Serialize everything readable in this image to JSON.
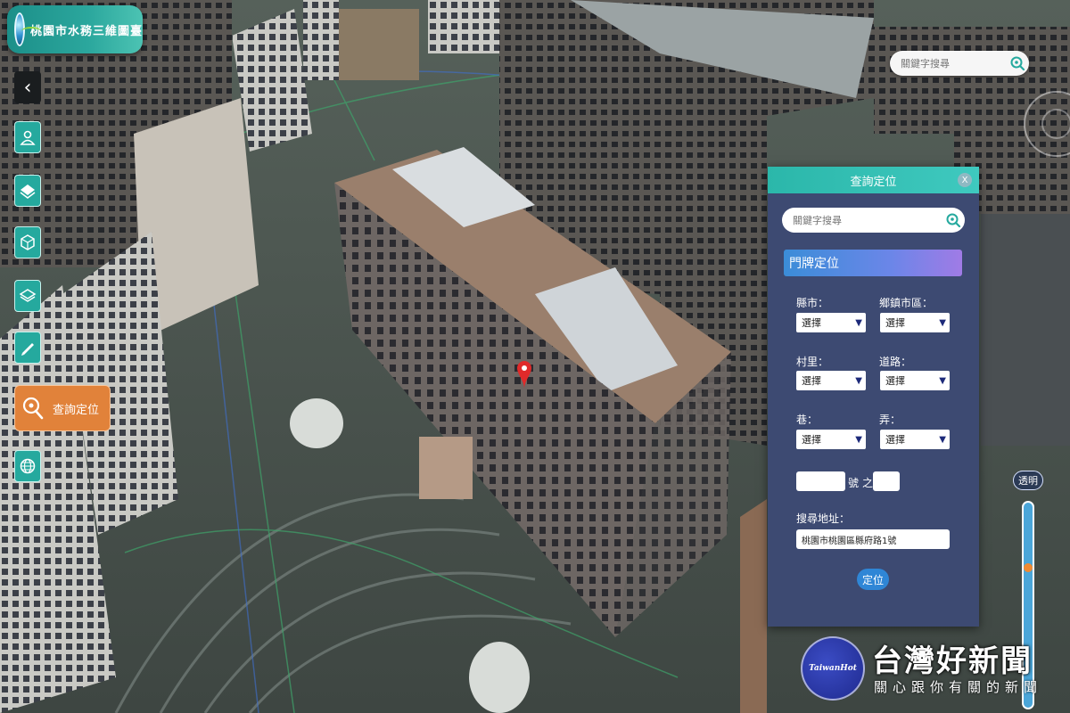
{
  "app": {
    "title": "桃園市水務三維圖臺"
  },
  "sidebar": {
    "collapse_glyph": "‹",
    "items": [
      {
        "icon": "person-icon"
      },
      {
        "icon": "layer-card-icon"
      },
      {
        "icon": "box-tool-icon"
      },
      {
        "icon": "layers-icon"
      },
      {
        "icon": "ruler-pencil-icon"
      },
      {
        "icon": "search-icon",
        "label": "查詢定位",
        "active": true
      },
      {
        "icon": "globe-icon"
      }
    ]
  },
  "top_search": {
    "placeholder": "關鍵字搜尋"
  },
  "panel": {
    "title": "查詢定位",
    "close_glyph": "X",
    "search_placeholder": "關鍵字搜尋",
    "section": "門牌定位",
    "fields": {
      "county_label": "縣市：",
      "county_value": "選擇",
      "district_label": "鄉鎮市區：",
      "district_value": "選擇",
      "village_label": "村里：",
      "village_value": "選擇",
      "road_label": "道路：",
      "road_value": "選擇",
      "lane_label": "巷：",
      "lane_value": "選擇",
      "alley_label": "弄：",
      "alley_value": "選擇",
      "number_suffix": "號",
      "of_label": "之",
      "address_label": "搜尋地址：",
      "address_value": "桃園市桃園區縣府路1號"
    },
    "locate_button": "定位"
  },
  "opacity": {
    "label": "透明",
    "level": 0.3
  },
  "watermark": {
    "brand": "TaiwanHot",
    "title": "台灣好新聞",
    "subtitle": "關心跟你有關的新聞"
  },
  "colors": {
    "accent_teal": "#25a99e",
    "active_orange": "#e1823a",
    "panel_bg": "#3d4a72",
    "location_pin": "#e02a2a"
  }
}
